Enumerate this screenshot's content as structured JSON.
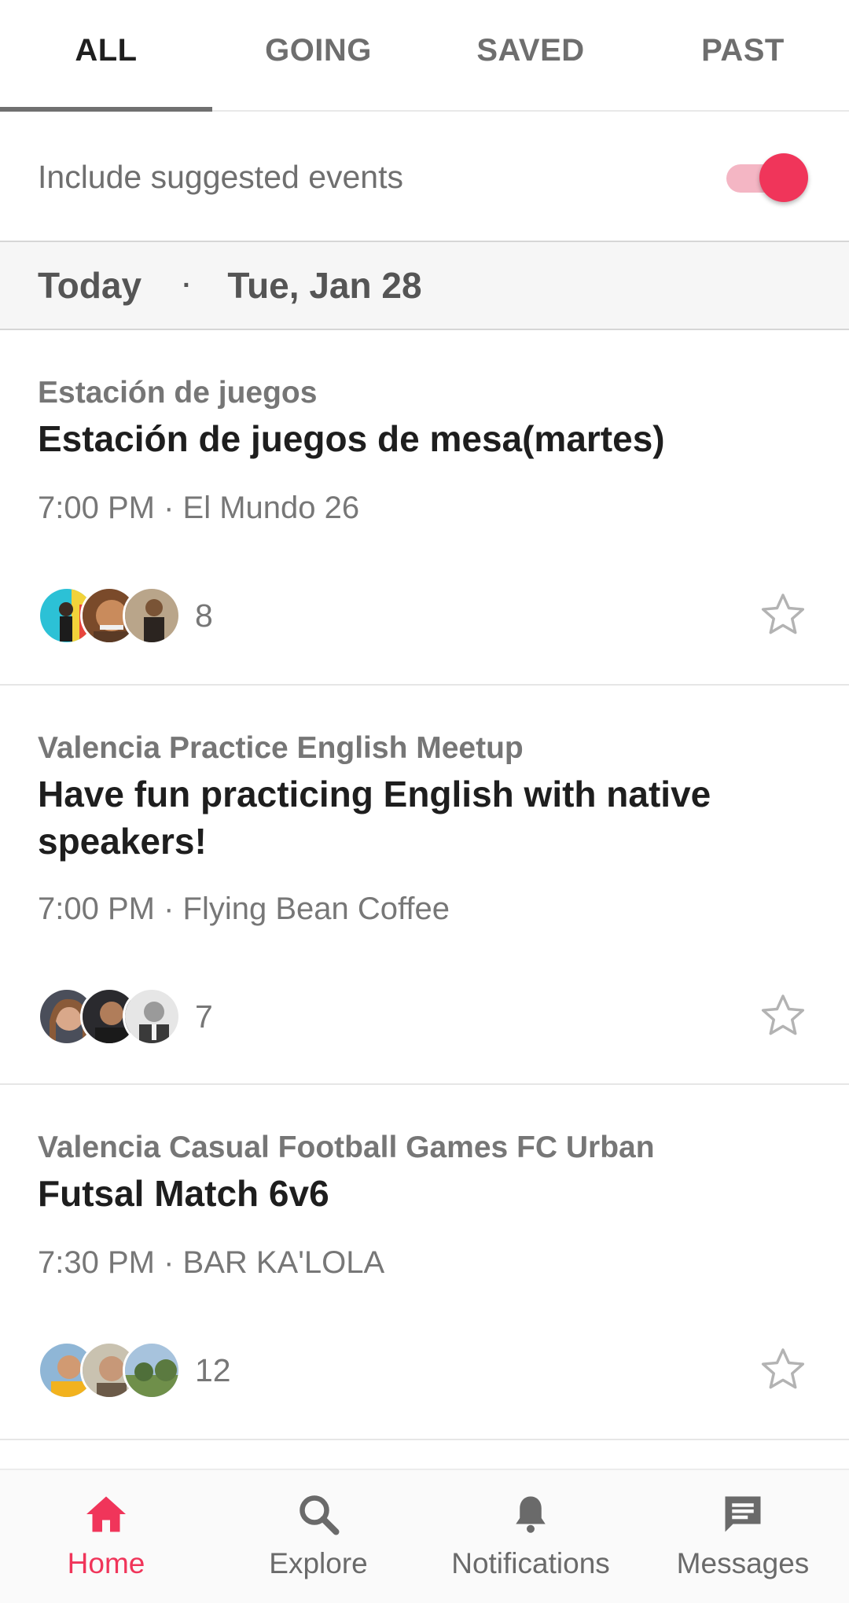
{
  "tabs": [
    {
      "label": "ALL",
      "active": true
    },
    {
      "label": "GOING",
      "active": false
    },
    {
      "label": "SAVED",
      "active": false
    },
    {
      "label": "PAST",
      "active": false
    }
  ],
  "suggested": {
    "label": "Include suggested events",
    "enabled": true
  },
  "date_header": {
    "today": "Today",
    "date": "Tue, Jan 28"
  },
  "events": [
    {
      "group": "Estación de juegos",
      "title": "Estación de juegos de mesa(martes)",
      "time": "7:00 PM",
      "venue": "El Mundo 26",
      "meta": "7:00 PM · El Mundo 26",
      "attendee_count": "8",
      "saved": false
    },
    {
      "group": "Valencia Practice English Meetup",
      "title": "Have fun practicing English with native speakers!",
      "time": "7:00 PM",
      "venue": "Flying Bean Coffee",
      "meta": "7:00 PM · Flying Bean Coffee",
      "attendee_count": "7",
      "saved": false
    },
    {
      "group": "Valencia Casual Football Games FC Urban",
      "title": "Futsal Match 6v6",
      "time": "7:30 PM",
      "venue": "BAR KA'LOLA",
      "meta": "7:30 PM · BAR KA'LOLA",
      "attendee_count": "12",
      "saved": false
    }
  ],
  "bottom_nav": [
    {
      "label": "Home",
      "icon": "home-icon",
      "active": true
    },
    {
      "label": "Explore",
      "icon": "search-icon",
      "active": false
    },
    {
      "label": "Notifications",
      "icon": "bell-icon",
      "active": false
    },
    {
      "label": "Messages",
      "icon": "message-icon",
      "active": false
    }
  ],
  "colors": {
    "accent": "#f0355a",
    "accent_light": "#f4b6c4",
    "text_muted": "#767676"
  }
}
